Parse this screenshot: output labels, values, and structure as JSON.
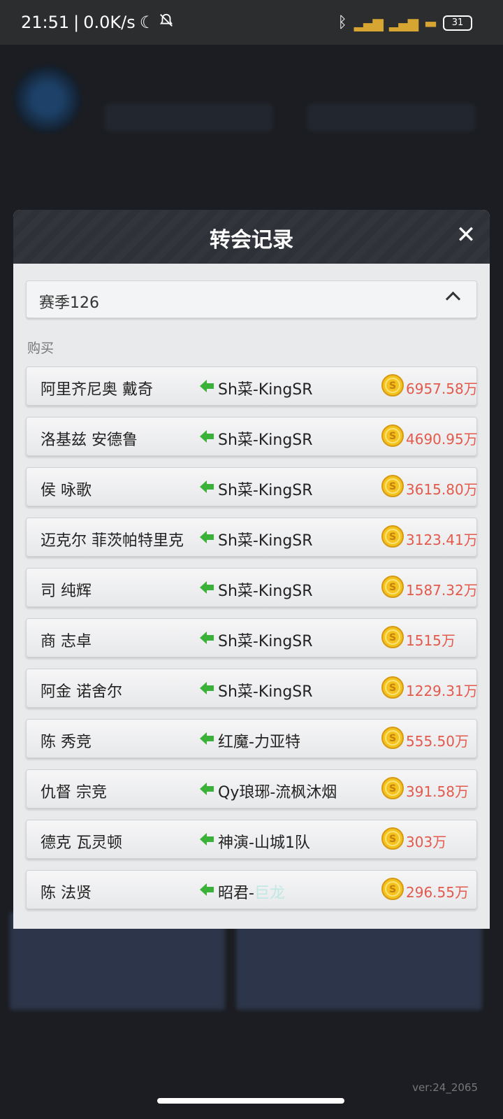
{
  "status_bar": {
    "time": "21:51",
    "net_speed": "0.0K/s",
    "battery": "31"
  },
  "background": {
    "version": "ver:24_2065"
  },
  "modal": {
    "title": "转会记录",
    "close_symbol": "✕",
    "season": "赛季126",
    "section_label": "购买",
    "records": [
      {
        "player": "阿里齐尼奥 戴奇",
        "team": "Sh菜-KingSR",
        "price": "6957.58万"
      },
      {
        "player": "洛基兹 安德鲁",
        "team": "Sh菜-KingSR",
        "price": "4690.95万"
      },
      {
        "player": "侯 咏歌",
        "team": "Sh菜-KingSR",
        "price": "3615.80万"
      },
      {
        "player": "迈克尔 菲茨帕特里克",
        "team": "Sh菜-KingSR",
        "price": "3123.41万"
      },
      {
        "player": "司 纯辉",
        "team": "Sh菜-KingSR",
        "price": "1587.32万"
      },
      {
        "player": "商 志卓",
        "team": "Sh菜-KingSR",
        "price": "1515万"
      },
      {
        "player": "阿金 诺舍尔",
        "team": "Sh菜-KingSR",
        "price": "1229.31万"
      },
      {
        "player": "陈 秀竞",
        "team": "红魔-力亚特",
        "price": "555.50万"
      },
      {
        "player": "仇督 宗竞",
        "team": "Qy琅琊-流枫沐烟",
        "price": "391.58万"
      },
      {
        "player": "德克 瓦灵顿",
        "team": "神演-山城1队",
        "price": "303万"
      },
      {
        "player": "陈 法贤",
        "team": "昭君-",
        "team_faded": "巨龙",
        "price": "296.55万"
      }
    ]
  },
  "colors": {
    "price": "#e35a4c",
    "arrow": "#3cb13a",
    "coin": "#f4c21c",
    "header_bg": "#2e3238"
  },
  "icons": [
    "moon-icon",
    "mute-bell-icon",
    "bluetooth-icon",
    "signal-icon",
    "wifi-icon",
    "battery-icon",
    "close-icon",
    "chevron-up-icon",
    "arrow-left-icon",
    "coin-icon"
  ]
}
